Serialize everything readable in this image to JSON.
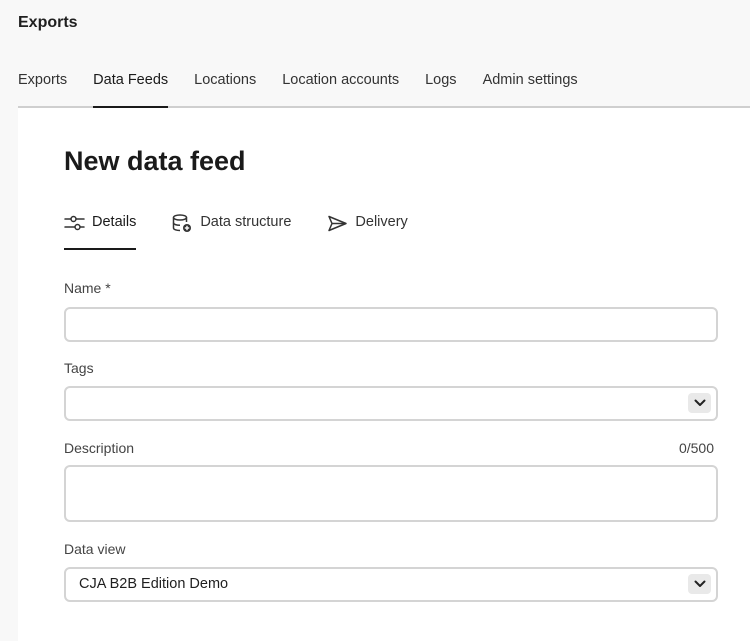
{
  "app": {
    "title": "Exports"
  },
  "top_tabs": [
    {
      "label": "Exports",
      "active": false
    },
    {
      "label": "Data Feeds",
      "active": true
    },
    {
      "label": "Locations",
      "active": false
    },
    {
      "label": "Location accounts",
      "active": false
    },
    {
      "label": "Logs",
      "active": false
    },
    {
      "label": "Admin settings",
      "active": false
    }
  ],
  "page": {
    "title": "New data feed"
  },
  "sub_tabs": [
    {
      "label": "Details",
      "icon": "sliders-icon",
      "active": true
    },
    {
      "label": "Data structure",
      "icon": "database-add-icon",
      "active": false
    },
    {
      "label": "Delivery",
      "icon": "send-icon",
      "active": false
    }
  ],
  "form": {
    "name": {
      "label": "Name *",
      "value": "",
      "placeholder": ""
    },
    "tags": {
      "label": "Tags",
      "value": ""
    },
    "description": {
      "label": "Description",
      "value": "",
      "counter": "0/500"
    },
    "data_view": {
      "label": "Data view",
      "value": "CJA B2B Edition Demo"
    }
  }
}
